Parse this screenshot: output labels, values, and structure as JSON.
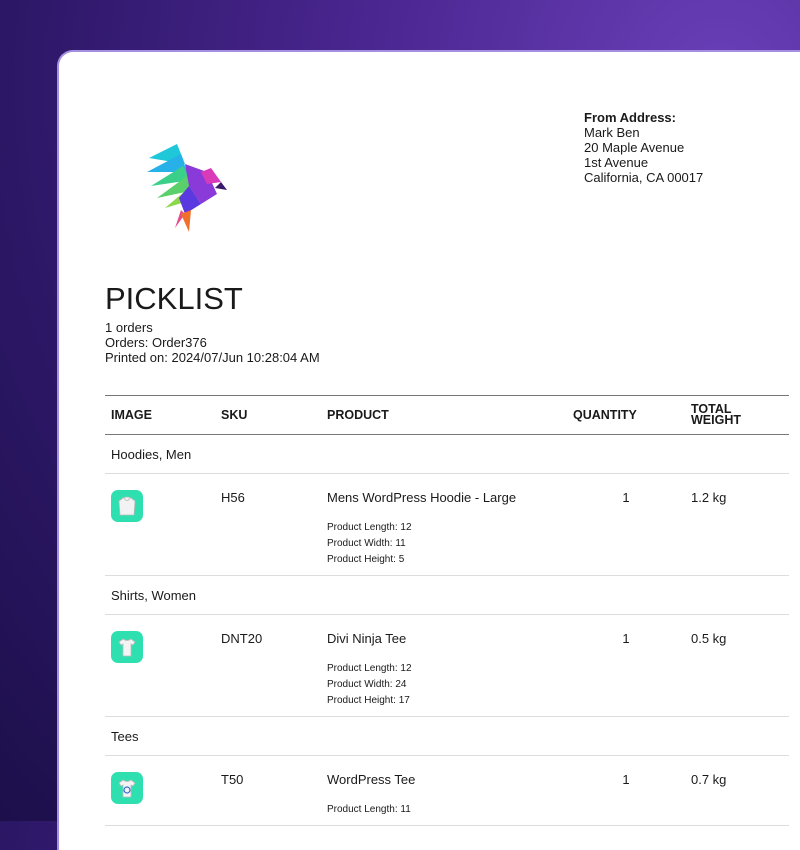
{
  "header": {
    "from_label": "From Address:",
    "from_lines": [
      "Mark Ben",
      "20 Maple Avenue",
      "1st Avenue",
      "California, CA 00017"
    ]
  },
  "logo": {
    "icon": "hummingbird-logo"
  },
  "picklist": {
    "title": "PICKLIST",
    "orders_count": "1 orders",
    "orders": "Orders: Order376",
    "printed_on": "Printed on: 2024/07/Jun 10:28:04 AM"
  },
  "table": {
    "columns": [
      "IMAGE",
      "SKU",
      "PRODUCT",
      "QUANTITY",
      "TOTAL WEIGHT"
    ],
    "groups": [
      {
        "category": "Hoodies, Men",
        "items": [
          {
            "icon": "hoodie-icon",
            "sku": "H56",
            "product": "Mens WordPress Hoodie - Large",
            "attributes": [
              "Product Length: 12",
              "Product Width: 11",
              "Product Height: 5"
            ],
            "quantity": "1",
            "weight": "1.2 kg"
          }
        ]
      },
      {
        "category": "Shirts, Women",
        "items": [
          {
            "icon": "tshirt-icon",
            "sku": "DNT20",
            "product": "Divi Ninja Tee",
            "attributes": [
              "Product Length: 12",
              "Product Width: 24",
              "Product Height: 17"
            ],
            "quantity": "1",
            "weight": "0.5 kg"
          }
        ]
      },
      {
        "category": "Tees",
        "items": [
          {
            "icon": "tee-icon",
            "sku": "T50",
            "product": "WordPress Tee",
            "attributes": [
              "Product Length: 11"
            ],
            "quantity": "1",
            "weight": "0.7 kg"
          }
        ]
      }
    ]
  },
  "colors": {
    "accent": "#2ee0b0",
    "background": "#4a2690"
  }
}
